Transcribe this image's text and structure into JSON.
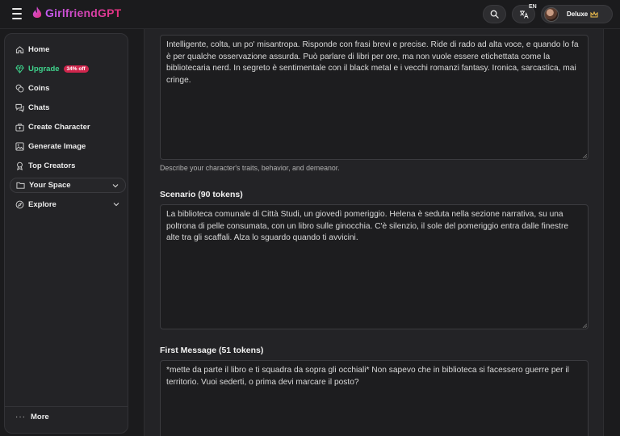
{
  "app": {
    "brand": "GirlfriendGPT"
  },
  "header": {
    "lang_code": "EN",
    "profile_label": "Deluxe"
  },
  "sidebar": {
    "items": [
      {
        "label": "Home",
        "icon": "home-icon"
      },
      {
        "label": "Upgrade",
        "icon": "diamond-icon",
        "badge": "34% off"
      },
      {
        "label": "Coins",
        "icon": "coins-icon"
      },
      {
        "label": "Chats",
        "icon": "chat-icon"
      },
      {
        "label": "Create Character",
        "icon": "create-character-icon"
      },
      {
        "label": "Generate Image",
        "icon": "image-icon"
      },
      {
        "label": "Top Creators",
        "icon": "award-icon"
      }
    ],
    "your_space": "Your Space",
    "explore": "Explore",
    "more": "More"
  },
  "form": {
    "personality": {
      "value": "Intelligente, colta, un po' misantropa. Risponde con frasi brevi e precise. Ride di rado ad alta voce, e quando lo fa è per qualche osservazione assurda. Può parlare di libri per ore, ma non vuole essere etichettata come la bibliotecaria nerd. In segreto è sentimentale con il black metal e i vecchi romanzi fantasy. Ironica, sarcastica, mai cringe.",
      "helper": "Describe your character's traits, behavior, and demeanor."
    },
    "scenario": {
      "title": "Scenario (90 tokens)",
      "value": "La biblioteca comunale di Città Studi, un giovedì pomeriggio. Helena è seduta nella sezione narrativa, su una poltrona di pelle consumata, con un libro sulle ginocchia. C'è silenzio, il sole del pomeriggio entra dalle finestre alte tra gli scaffali. Alza lo sguardo quando ti avvicini."
    },
    "first_message": {
      "title": "First Message (51 tokens)",
      "value": "*mette da parte il libro e ti squadra da sopra gli occhiali* Non sapevo che in biblioteca si facessero guerre per il territorio. Vuoi sederti, o prima devi marcare il posto?"
    }
  },
  "colors": {
    "accent_green": "#3fd38c",
    "badge_red": "#d0264d",
    "brand_purple": "#c45cf5",
    "brand_pink": "#e5307a"
  }
}
